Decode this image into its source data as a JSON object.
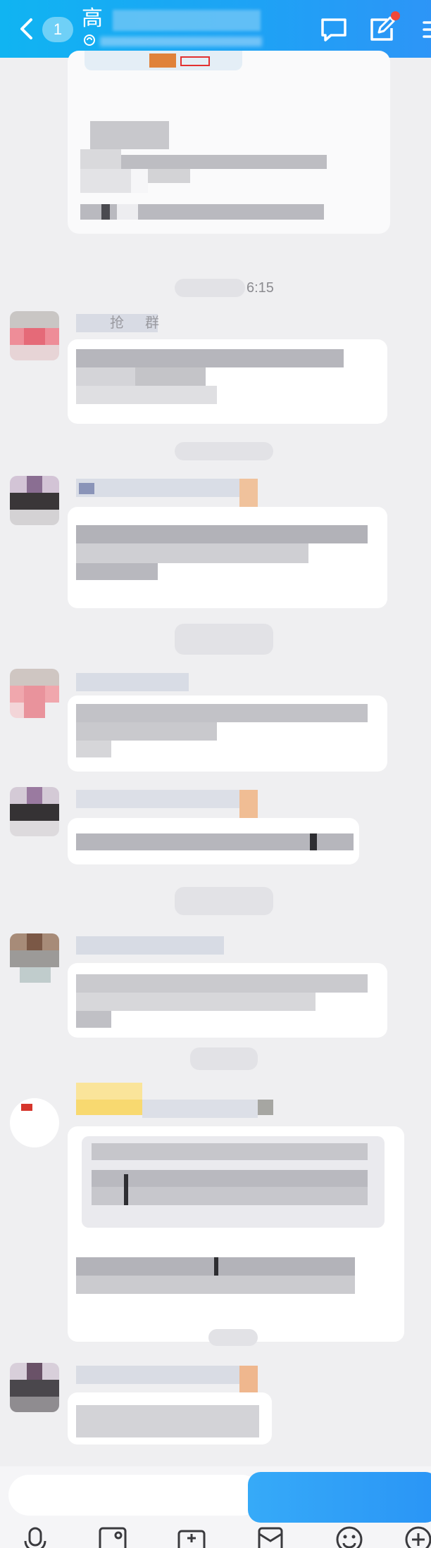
{
  "header": {
    "unread_count": "1",
    "title_visible": "高",
    "tabs": [
      "chat-icon",
      "edit-icon"
    ],
    "accent": "#1ea2f5"
  },
  "messages": {
    "timestamp_1": "6:15",
    "snippet_1": "抢",
    "snippet_2": "群"
  },
  "input_bar": {
    "placeholder": "",
    "tools": [
      "microphone-icon",
      "image-icon",
      "camera-icon",
      "red-packet-icon",
      "emoji-icon",
      "plus-icon"
    ]
  },
  "colors": {
    "header_gradient_start": "#10b4f2",
    "header_gradient_end": "#2d95f7",
    "background": "#efeff1",
    "badge": "#f0483a"
  }
}
